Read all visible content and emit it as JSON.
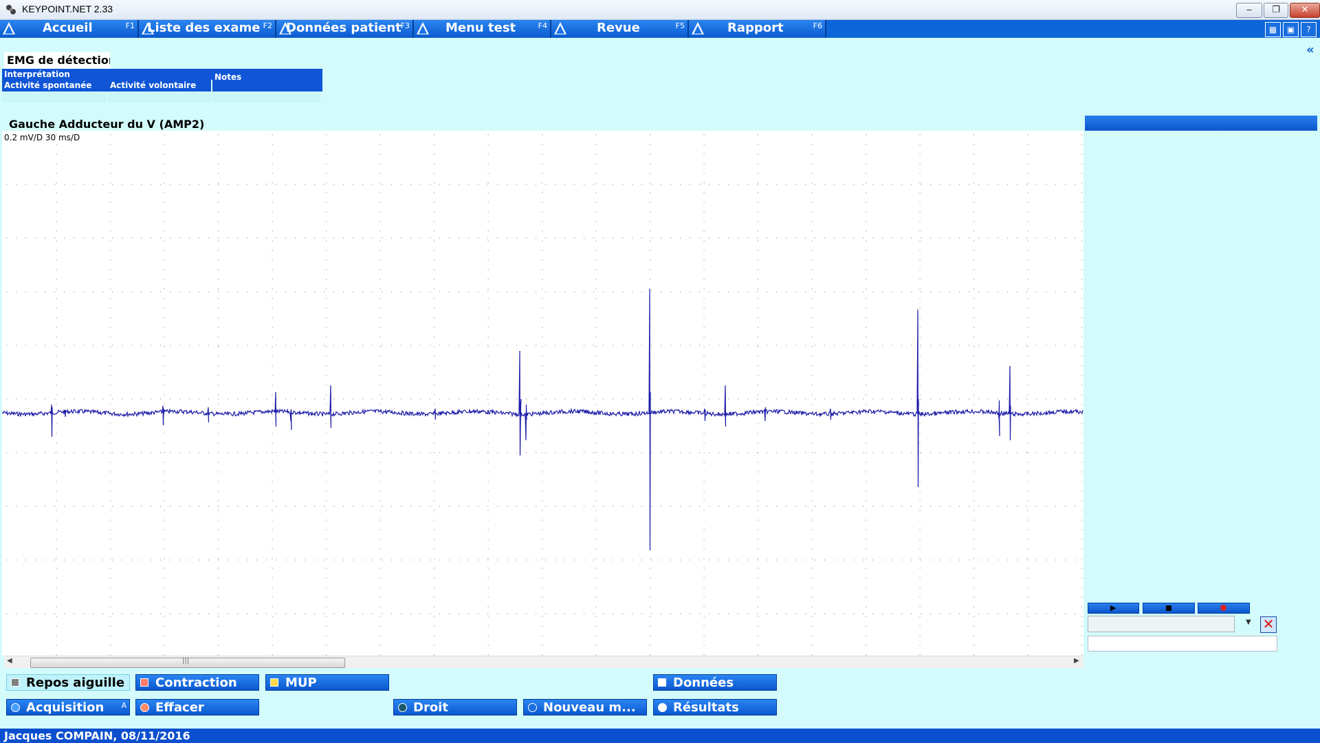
{
  "window": {
    "title": "KEYPOINT.NET 2.33",
    "min_label": "‒",
    "max_label": "❐",
    "close_label": "✕"
  },
  "tabs": [
    {
      "label": "Accueil",
      "key": "F1"
    },
    {
      "label": "Liste des exame...",
      "key": "F2"
    },
    {
      "label": "Données patient",
      "key": "F3"
    },
    {
      "label": "Menu test",
      "key": "F4"
    },
    {
      "label": "Revue",
      "key": "F5"
    },
    {
      "label": "Rapport",
      "key": "F6"
    }
  ],
  "toolbar_icons": [
    "layout-icon",
    "print-icon",
    "help-icon"
  ],
  "toolbar_labels": [
    "▦",
    "▣",
    "?"
  ],
  "exam": {
    "title": "EMG de détection",
    "interpretation_label": "Interprétation",
    "spontaneous_label": "Activité spontanée",
    "voluntary_label": "Activité volontaire",
    "notes_label": "Notes"
  },
  "graph": {
    "title": "Gauche Adducteur du V (AMP2)",
    "scale": "0.2 mV/D 30 ms/D"
  },
  "bottom_buttons_row1": [
    {
      "label": "Repos aiguille",
      "marker_color": "#808080",
      "active": true
    },
    {
      "label": "Contraction",
      "marker_color": "#ff7a6a",
      "active": false
    },
    {
      "label": "MUP",
      "marker_color": "#ffd84a",
      "active": false
    },
    {
      "label": "Données",
      "marker_color": "#ffffff",
      "active": false
    }
  ],
  "bottom_buttons_row2": [
    {
      "label": "Acquisition",
      "key": "A",
      "marker_color": "#4aa0ff"
    },
    {
      "label": "Effacer",
      "marker_color": "#ff8a6a"
    },
    {
      "label": "Droit",
      "marker_color": "#1a5a6a"
    },
    {
      "label": "Nouveau m...",
      "marker_color": "#1a6fe0"
    },
    {
      "label": "Résultats",
      "marker_color": "#ffffff"
    }
  ],
  "status": {
    "text": "Jacques COMPAIN, 08/11/2016"
  },
  "colors": {
    "tab_blue": "#0d66d9",
    "background": "#d4fbfb",
    "trace": "#1a1aa8"
  }
}
